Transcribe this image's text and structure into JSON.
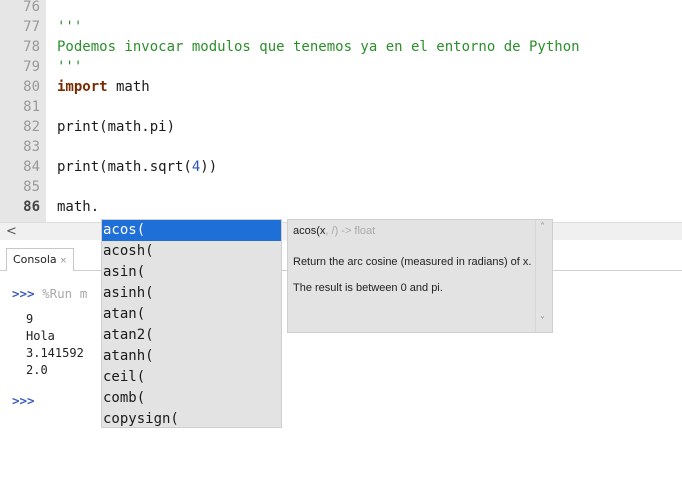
{
  "editor": {
    "lines": [
      {
        "num": "76",
        "code": ""
      },
      {
        "num": "77",
        "code": "'''"
      },
      {
        "num": "78",
        "code": "Podemos invocar modulos que tenemos ya en el entorno de Python"
      },
      {
        "num": "79",
        "code": "'''"
      },
      {
        "num": "80",
        "kw": "import",
        "rest": " math"
      },
      {
        "num": "81",
        "code": ""
      },
      {
        "num": "82",
        "code": "print(math.pi)"
      },
      {
        "num": "83",
        "code": ""
      },
      {
        "num": "84",
        "pre": "print(math.sqrt(",
        "n": "4",
        "post": "))"
      },
      {
        "num": "85",
        "code": ""
      },
      {
        "num": "86",
        "code": "math."
      }
    ]
  },
  "scrollbar": {
    "left_arrow": "<"
  },
  "panel": {
    "tab_label": "Consola",
    "tab_close": "×"
  },
  "console": {
    "prompt": ">>>",
    "run_text": " %Run m",
    "outputs": [
      "9",
      "Hola",
      "3.141592",
      "2.0"
    ],
    "prompt2": ">>>"
  },
  "autocomplete": {
    "items": [
      "acos(",
      "acosh(",
      "asin(",
      "asinh(",
      "atan(",
      "atan2(",
      "atanh(",
      "ceil(",
      "comb(",
      "copysign("
    ],
    "selected_index": 0
  },
  "doc": {
    "sig_name": "acos(x",
    "sig_rest": ", /) -> float",
    "body1": "Return the arc cosine (measured in radians) of x.",
    "body2": "The result is between 0 and pi.",
    "up": "˄",
    "down": "˅"
  }
}
